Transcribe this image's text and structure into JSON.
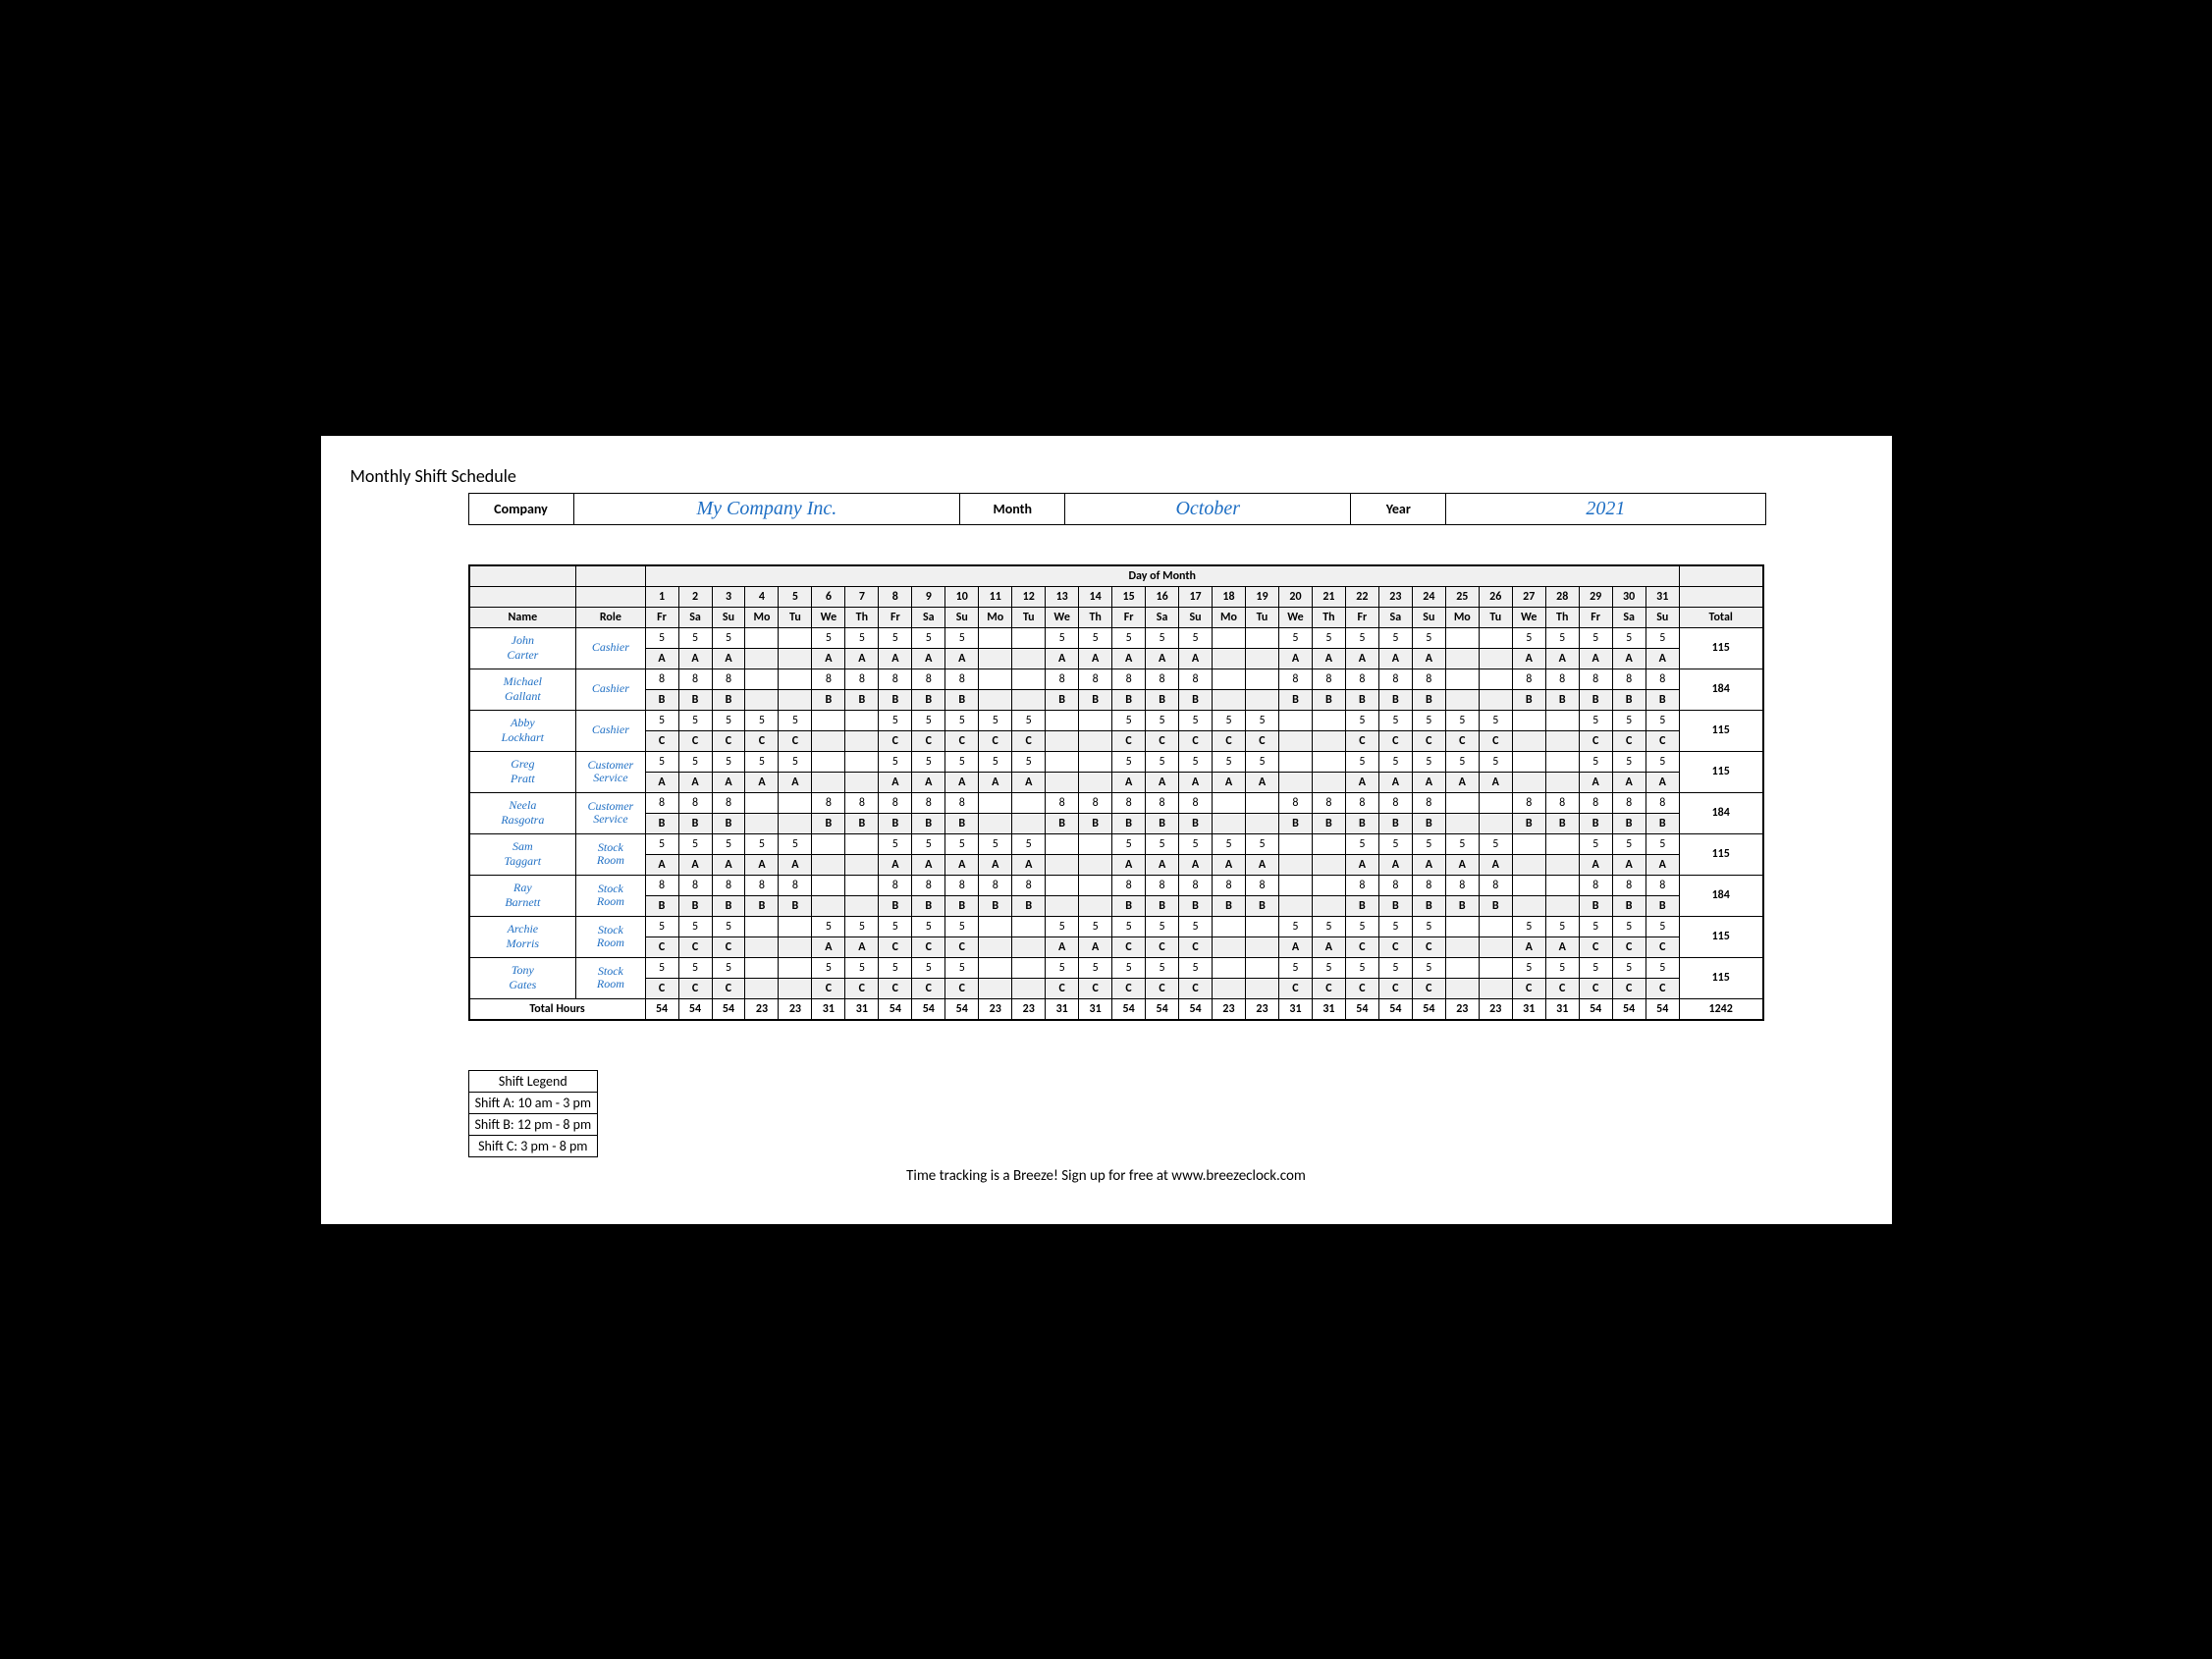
{
  "title": "Monthly Shift Schedule",
  "header": {
    "company_label": "Company",
    "company_value": "My Company Inc.",
    "month_label": "Month",
    "month_value": "October",
    "year_label": "Year",
    "year_value": "2021"
  },
  "table": {
    "day_of_month_label": "Day of Month",
    "name_label": "Name",
    "role_label": "Role",
    "total_label": "Total",
    "total_hours_label": "Total Hours",
    "days": [
      "1",
      "2",
      "3",
      "4",
      "5",
      "6",
      "7",
      "8",
      "9",
      "10",
      "11",
      "12",
      "13",
      "14",
      "15",
      "16",
      "17",
      "18",
      "19",
      "20",
      "21",
      "22",
      "23",
      "24",
      "25",
      "26",
      "27",
      "28",
      "29",
      "30",
      "31"
    ],
    "weekdays": [
      "Fr",
      "Sa",
      "Su",
      "Mo",
      "Tu",
      "We",
      "Th",
      "Fr",
      "Sa",
      "Su",
      "Mo",
      "Tu",
      "We",
      "Th",
      "Fr",
      "Sa",
      "Su",
      "Mo",
      "Tu",
      "We",
      "Th",
      "Fr",
      "Sa",
      "Su",
      "Mo",
      "Tu",
      "We",
      "Th",
      "Fr",
      "Sa",
      "Su"
    ]
  },
  "employees": [
    {
      "name": "John Carter",
      "role": "Cashier",
      "pattern": "A",
      "hours": [
        "5",
        "5",
        "5",
        "",
        "",
        "5",
        "5",
        "5",
        "5",
        "5",
        "",
        "",
        "5",
        "5",
        "5",
        "5",
        "5",
        "",
        "",
        "5",
        "5",
        "5",
        "5",
        "5",
        "",
        "",
        "5",
        "5",
        "5",
        "5",
        "5"
      ],
      "shifts": [
        "A",
        "A",
        "A",
        "",
        "",
        "A",
        "A",
        "A",
        "A",
        "A",
        "",
        "",
        "A",
        "A",
        "A",
        "A",
        "A",
        "",
        "",
        "A",
        "A",
        "A",
        "A",
        "A",
        "",
        "",
        "A",
        "A",
        "A",
        "A",
        "A"
      ],
      "total": "115"
    },
    {
      "name": "Michael Gallant",
      "role": "Cashier",
      "pattern": "B",
      "hours": [
        "8",
        "8",
        "8",
        "",
        "",
        "8",
        "8",
        "8",
        "8",
        "8",
        "",
        "",
        "8",
        "8",
        "8",
        "8",
        "8",
        "",
        "",
        "8",
        "8",
        "8",
        "8",
        "8",
        "",
        "",
        "8",
        "8",
        "8",
        "8",
        "8"
      ],
      "shifts": [
        "B",
        "B",
        "B",
        "",
        "",
        "B",
        "B",
        "B",
        "B",
        "B",
        "",
        "",
        "B",
        "B",
        "B",
        "B",
        "B",
        "",
        "",
        "B",
        "B",
        "B",
        "B",
        "B",
        "",
        "",
        "B",
        "B",
        "B",
        "B",
        "B"
      ],
      "total": "184"
    },
    {
      "name": "Abby Lockhart",
      "role": "Cashier",
      "pattern": "C",
      "hours": [
        "5",
        "5",
        "5",
        "5",
        "5",
        "",
        "",
        "5",
        "5",
        "5",
        "5",
        "5",
        "",
        "",
        "5",
        "5",
        "5",
        "5",
        "5",
        "",
        "",
        "5",
        "5",
        "5",
        "5",
        "5",
        "",
        "",
        "5",
        "5",
        "5"
      ],
      "shifts": [
        "C",
        "C",
        "C",
        "C",
        "C",
        "",
        "",
        "C",
        "C",
        "C",
        "C",
        "C",
        "",
        "",
        "C",
        "C",
        "C",
        "C",
        "C",
        "",
        "",
        "C",
        "C",
        "C",
        "C",
        "C",
        "",
        "",
        "C",
        "C",
        "C"
      ],
      "total": "115"
    },
    {
      "name": "Greg Pratt",
      "role": "Customer Service",
      "pattern": "A",
      "hours": [
        "5",
        "5",
        "5",
        "5",
        "5",
        "",
        "",
        "5",
        "5",
        "5",
        "5",
        "5",
        "",
        "",
        "5",
        "5",
        "5",
        "5",
        "5",
        "",
        "",
        "5",
        "5",
        "5",
        "5",
        "5",
        "",
        "",
        "5",
        "5",
        "5"
      ],
      "shifts": [
        "A",
        "A",
        "A",
        "A",
        "A",
        "",
        "",
        "A",
        "A",
        "A",
        "A",
        "A",
        "",
        "",
        "A",
        "A",
        "A",
        "A",
        "A",
        "",
        "",
        "A",
        "A",
        "A",
        "A",
        "A",
        "",
        "",
        "A",
        "A",
        "A"
      ],
      "total": "115"
    },
    {
      "name": "Neela Rasgotra",
      "role": "Customer Service",
      "pattern": "B",
      "hours": [
        "8",
        "8",
        "8",
        "",
        "",
        "8",
        "8",
        "8",
        "8",
        "8",
        "",
        "",
        "8",
        "8",
        "8",
        "8",
        "8",
        "",
        "",
        "8",
        "8",
        "8",
        "8",
        "8",
        "",
        "",
        "8",
        "8",
        "8",
        "8",
        "8"
      ],
      "shifts": [
        "B",
        "B",
        "B",
        "",
        "",
        "B",
        "B",
        "B",
        "B",
        "B",
        "",
        "",
        "B",
        "B",
        "B",
        "B",
        "B",
        "",
        "",
        "B",
        "B",
        "B",
        "B",
        "B",
        "",
        "",
        "B",
        "B",
        "B",
        "B",
        "B"
      ],
      "total": "184"
    },
    {
      "name": "Sam Taggart",
      "role": "Stock Room",
      "pattern": "A",
      "hours": [
        "5",
        "5",
        "5",
        "5",
        "5",
        "",
        "",
        "5",
        "5",
        "5",
        "5",
        "5",
        "",
        "",
        "5",
        "5",
        "5",
        "5",
        "5",
        "",
        "",
        "5",
        "5",
        "5",
        "5",
        "5",
        "",
        "",
        "5",
        "5",
        "5"
      ],
      "shifts": [
        "A",
        "A",
        "A",
        "A",
        "A",
        "",
        "",
        "A",
        "A",
        "A",
        "A",
        "A",
        "",
        "",
        "A",
        "A",
        "A",
        "A",
        "A",
        "",
        "",
        "A",
        "A",
        "A",
        "A",
        "A",
        "",
        "",
        "A",
        "A",
        "A"
      ],
      "total": "115"
    },
    {
      "name": "Ray Barnett",
      "role": "Stock Room",
      "pattern": "B",
      "hours": [
        "8",
        "8",
        "8",
        "8",
        "8",
        "",
        "",
        "8",
        "8",
        "8",
        "8",
        "8",
        "",
        "",
        "8",
        "8",
        "8",
        "8",
        "8",
        "",
        "",
        "8",
        "8",
        "8",
        "8",
        "8",
        "",
        "",
        "8",
        "8",
        "8"
      ],
      "shifts": [
        "B",
        "B",
        "B",
        "B",
        "B",
        "",
        "",
        "B",
        "B",
        "B",
        "B",
        "B",
        "",
        "",
        "B",
        "B",
        "B",
        "B",
        "B",
        "",
        "",
        "B",
        "B",
        "B",
        "B",
        "B",
        "",
        "",
        "B",
        "B",
        "B"
      ],
      "total": "184"
    },
    {
      "name": "Archie Morris",
      "role": "Stock Room",
      "pattern": "C",
      "hours": [
        "5",
        "5",
        "5",
        "",
        "",
        "5",
        "5",
        "5",
        "5",
        "5",
        "",
        "",
        "5",
        "5",
        "5",
        "5",
        "5",
        "",
        "",
        "5",
        "5",
        "5",
        "5",
        "5",
        "",
        "",
        "5",
        "5",
        "5",
        "5",
        "5"
      ],
      "shifts": [
        "C",
        "C",
        "C",
        "",
        "",
        "A",
        "A",
        "C",
        "C",
        "C",
        "",
        "",
        "A",
        "A",
        "C",
        "C",
        "C",
        "",
        "",
        "A",
        "A",
        "C",
        "C",
        "C",
        "",
        "",
        "A",
        "A",
        "C",
        "C",
        "C"
      ],
      "total": "115"
    },
    {
      "name": "Tony Gates",
      "role": "Stock Room",
      "pattern": "C",
      "hours": [
        "5",
        "5",
        "5",
        "",
        "",
        "5",
        "5",
        "5",
        "5",
        "5",
        "",
        "",
        "5",
        "5",
        "5",
        "5",
        "5",
        "",
        "",
        "5",
        "5",
        "5",
        "5",
        "5",
        "",
        "",
        "5",
        "5",
        "5",
        "5",
        "5"
      ],
      "shifts": [
        "C",
        "C",
        "C",
        "",
        "",
        "C",
        "C",
        "C",
        "C",
        "C",
        "",
        "",
        "C",
        "C",
        "C",
        "C",
        "C",
        "",
        "",
        "C",
        "C",
        "C",
        "C",
        "C",
        "",
        "",
        "C",
        "C",
        "C",
        "C",
        "C"
      ],
      "total": "115"
    }
  ],
  "column_totals": [
    "54",
    "54",
    "54",
    "23",
    "23",
    "31",
    "31",
    "54",
    "54",
    "54",
    "23",
    "23",
    "31",
    "31",
    "54",
    "54",
    "54",
    "23",
    "23",
    "31",
    "31",
    "54",
    "54",
    "54",
    "23",
    "23",
    "31",
    "31",
    "54",
    "54",
    "54"
  ],
  "grand_total": "1242",
  "legend": {
    "title": "Shift Legend",
    "rows": [
      "Shift A: 10 am - 3 pm",
      "Shift B: 12 pm - 8 pm",
      "Shift C: 3 pm - 8 pm"
    ]
  },
  "footer": "Time tracking is a Breeze! Sign up for free at www.breezeclock.com"
}
